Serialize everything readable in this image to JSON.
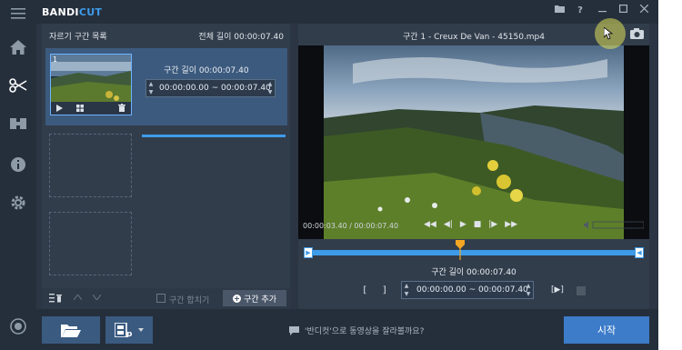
{
  "app": {
    "logo_main": "BANDI",
    "logo_accent": "CUT"
  },
  "segments": {
    "title": "자르기 구간 목록",
    "total_length": "전체 길이 00:00:07.40",
    "items": [
      {
        "number": "1",
        "length_label": "구간 길이 00:00:07.40",
        "start": "00:00:00.00",
        "separator": "~",
        "end": "00:00:07.40"
      }
    ],
    "merge_label": "구간 합치기",
    "add_label": "구간 추가"
  },
  "player": {
    "title": "구간 1 - Creux De Van - 45150.mp4",
    "current_time": "00:00:03.40 / 00:00:07.40",
    "progress": 0.46,
    "cut_length_label": "구간 길이 00:00:07.40",
    "cut_start": "00:00:00.00",
    "cut_separator": "~",
    "cut_end": "00:00:07.40",
    "bracket_open": "[",
    "bracket_close": "]"
  },
  "bottom": {
    "hint": "'반디컷'으로 동영상을 잘라볼까요?",
    "start_label": "시작"
  },
  "colors": {
    "accent": "#3d9be9",
    "start_button": "#3d7cc9",
    "background": "#2b3543"
  }
}
